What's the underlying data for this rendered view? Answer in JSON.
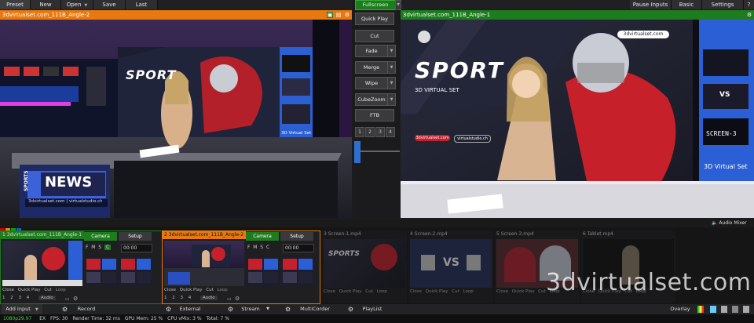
{
  "toolbar": {
    "preset": "Preset",
    "new": "New",
    "open": "Open",
    "save": "Save",
    "last": "Last",
    "pause_inputs": "Pause Inputs",
    "basic": "Basic",
    "settings": "Settings"
  },
  "preview": {
    "title": "3dvirtualset.com_111B_Angle-2"
  },
  "program": {
    "title": "3dvirtualset.com_111B_Angle-1",
    "overlay_url": "3dvirtualset.com",
    "screen_3": "SCREEN-3",
    "virtual_set_label": "3D Virtual Set",
    "sport_title": "SPORT",
    "sub_heading": "3D VIRTUAL SET",
    "pill_1": "3dvirtualset.com",
    "pill_2": "virtualstudio.ch",
    "vs": "VS"
  },
  "preview_scene": {
    "sport_title": "SPORT",
    "news": "NEWS",
    "sports_vertical": "SPORTS",
    "url_line": "3dvirtualset.com | virtualstudio.ch",
    "virtual_set_label": "3D Virtual Set"
  },
  "transitions": {
    "fullscreen": "Fullscreen",
    "quick_play": "Quick Play",
    "cut": "Cut",
    "fade": "Fade",
    "merge": "Merge",
    "wipe": "Wipe",
    "cubezoom": "CubeZoom",
    "ftb": "FTB",
    "n1": "1",
    "n2": "2",
    "n3": "3",
    "n4": "4"
  },
  "audio_mixer": "Audio Mixer",
  "inputs": [
    {
      "num": "1",
      "name": "3dvirtualset.com_111B_Angle-1",
      "camera": "Camera",
      "setup": "Setup",
      "time": "00:00"
    },
    {
      "num": "2",
      "name": "3dvirtualset.com_111B_Angle-2",
      "camera": "Camera",
      "setup": "Setup",
      "time": "00:00"
    },
    {
      "num": "3",
      "name": "Screen-1.mp4"
    },
    {
      "num": "4",
      "name": "Screen-2.mp4"
    },
    {
      "num": "5",
      "name": "Screen-3.mp4"
    },
    {
      "num": "6",
      "name": "Tablet.mp4"
    }
  ],
  "input_controls": {
    "close": "Close",
    "quick_play": "Quick Play",
    "cut": "Cut",
    "loop": "Loop",
    "audio": "Audio",
    "letters": [
      "F",
      "M",
      "S",
      "C"
    ],
    "n1": "1",
    "n2": "2",
    "n3": "3",
    "n4": "4"
  },
  "watermark": "3dvirtualset.com",
  "bottom": {
    "add_input": "Add Input",
    "record": "Record",
    "external": "External",
    "stream": "Stream",
    "multicorder": "MultiCorder",
    "playlist": "PlayList",
    "overlay": "Overlay"
  },
  "status": {
    "format": "1080p29.97",
    "ex": "EX",
    "fps_label": "FPS:",
    "fps": "30",
    "render_label": "Render Time:",
    "render": "32 ms",
    "gpu_label": "GPU Mem:",
    "gpu": "25 %",
    "cpu_label": "CPU vMix:",
    "cpu": "3 %",
    "total_label": "Total:",
    "total": "7 %"
  },
  "colors": {
    "preview_accent": "#e8790f",
    "program_accent": "#1d7c1d",
    "camera_button": "#1d7c1d",
    "status_green": "#3fd13f"
  }
}
